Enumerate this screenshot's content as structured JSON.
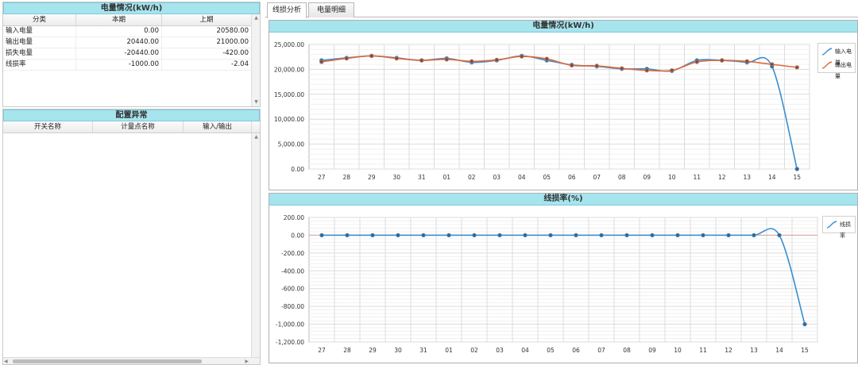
{
  "energy_panel": {
    "title": "电量情况(kW/h)",
    "columns": [
      "分类",
      "本期",
      "上期"
    ],
    "rows": [
      {
        "label": "输入电量",
        "current": "0.00",
        "previous": "20580.00"
      },
      {
        "label": "输出电量",
        "current": "20440.00",
        "previous": "21000.00"
      },
      {
        "label": "损失电量",
        "current": "-20440.00",
        "previous": "-420.00"
      },
      {
        "label": "线损率",
        "current": "-1000.00",
        "previous": "-2.04"
      }
    ]
  },
  "config_panel": {
    "title": "配置异常",
    "columns": [
      "开关名称",
      "计量点名称",
      "输入/输出"
    ]
  },
  "tabs": [
    {
      "label": "线损分析",
      "active": true
    },
    {
      "label": "电量明细",
      "active": false
    }
  ],
  "colors": {
    "header_bg": "#a6e4ee",
    "input_series": "#3a8fd0",
    "output_series": "#e0683a"
  },
  "chart_data": [
    {
      "type": "line",
      "title": "电量情况(kW/h)",
      "categories": [
        "27",
        "28",
        "29",
        "30",
        "31",
        "01",
        "02",
        "03",
        "04",
        "05",
        "06",
        "07",
        "08",
        "09",
        "10",
        "11",
        "12",
        "13",
        "14",
        "15"
      ],
      "ylim": [
        0,
        25000
      ],
      "yticks": [
        "25,000.00",
        "20,000.00",
        "15,000.00",
        "10,000.00",
        "5,000.00",
        "0.00"
      ],
      "grid": true,
      "legend_position": "right",
      "series": [
        {
          "name": "输入电量",
          "color": "#3a8fd0",
          "values": [
            21800,
            22300,
            22700,
            22300,
            21800,
            22200,
            21400,
            21800,
            22700,
            21800,
            20900,
            20600,
            20100,
            20100,
            19700,
            21800,
            21800,
            21400,
            20600,
            0
          ]
        },
        {
          "name": "输出电量",
          "color": "#e0683a",
          "values": [
            21500,
            22200,
            22700,
            22200,
            21800,
            22000,
            21600,
            21900,
            22600,
            22100,
            20800,
            20700,
            20200,
            19800,
            19800,
            21500,
            21800,
            21600,
            21000,
            20400
          ]
        }
      ]
    },
    {
      "type": "line",
      "title": "线损率(%)",
      "categories": [
        "27",
        "28",
        "29",
        "30",
        "31",
        "01",
        "02",
        "03",
        "04",
        "05",
        "06",
        "07",
        "08",
        "09",
        "10",
        "11",
        "12",
        "13",
        "14",
        "15"
      ],
      "ylim": [
        -1200,
        200
      ],
      "yticks": [
        "200.00",
        "0.00",
        "-200.00",
        "-400.00",
        "-600.00",
        "-800.00",
        "-1,000.00",
        "-1,200.00"
      ],
      "grid": true,
      "legend_position": "right",
      "series": [
        {
          "name": "线损率",
          "color": "#3a8fd0",
          "values": [
            0,
            0,
            0,
            0,
            0,
            0,
            0,
            0,
            0,
            0,
            0,
            0,
            0,
            0,
            0,
            0,
            0,
            0,
            0,
            -1000
          ]
        }
      ]
    }
  ]
}
